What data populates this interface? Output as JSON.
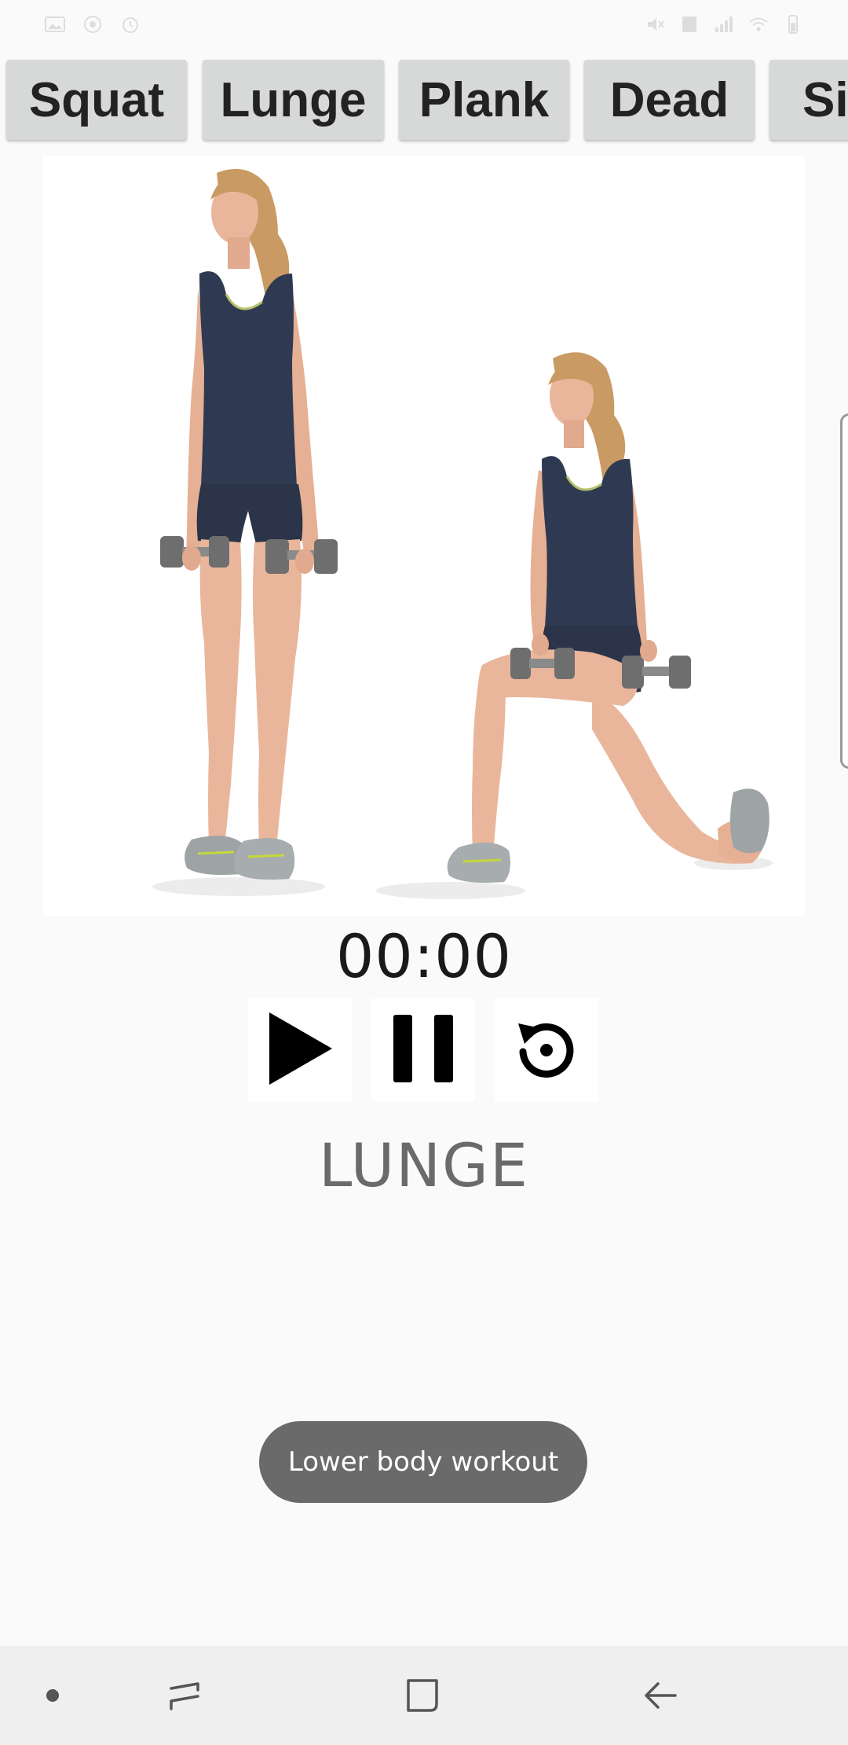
{
  "status_bar": {
    "left_icons": [
      "gallery-icon",
      "sync-icon",
      "alarm-icon"
    ],
    "right_icons": [
      "mute-icon",
      "nfc-icon",
      "signal-icon",
      "wifi-icon",
      "battery-icon"
    ]
  },
  "tabs": [
    {
      "label": "Squat"
    },
    {
      "label": "Lunge"
    },
    {
      "label": "Plank"
    },
    {
      "label": "Dead"
    },
    {
      "label": "Si"
    }
  ],
  "exercise": {
    "image_icon": "lunge-illustration",
    "timer": "00:00",
    "name": "LUNGE"
  },
  "controls": {
    "play_icon": "play-icon",
    "pause_icon": "pause-icon",
    "reset_icon": "reset-icon"
  },
  "toast": {
    "text": "Lower body workout"
  },
  "nav_bar": {
    "items": [
      "dot-icon",
      "recents-icon",
      "home-icon",
      "back-icon"
    ]
  },
  "colors": {
    "background": "#fafafa",
    "tab_bg": "#d7d8d8",
    "toast_bg": "#6a6a6a",
    "exercise_name": "#6a6a6a",
    "outfit_navy": "#2f3a52",
    "skin": "#e9b69c",
    "hair": "#c99a63"
  }
}
